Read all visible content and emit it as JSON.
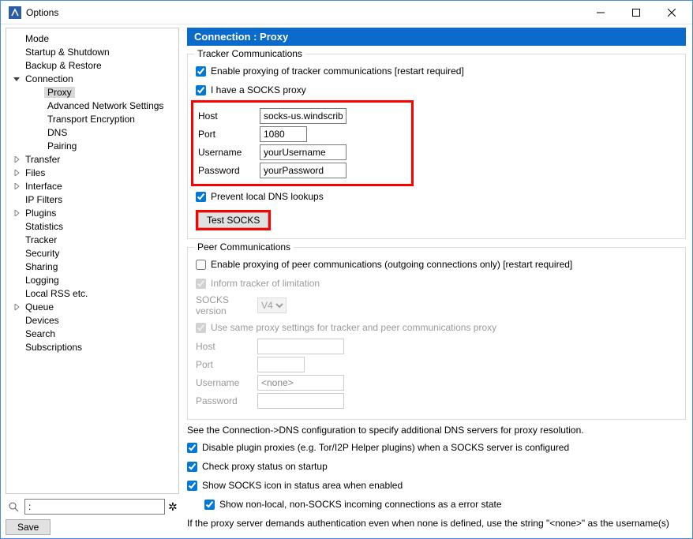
{
  "window": {
    "title": "Options"
  },
  "sidebar": {
    "items": [
      {
        "label": "Mode",
        "level": 1,
        "expand": "none"
      },
      {
        "label": "Startup & Shutdown",
        "level": 1,
        "expand": "none"
      },
      {
        "label": "Backup & Restore",
        "level": 1,
        "expand": "none"
      },
      {
        "label": "Connection",
        "level": 1,
        "expand": "open"
      },
      {
        "label": "Proxy",
        "level": 2,
        "expand": "none",
        "selected": true
      },
      {
        "label": "Advanced Network Settings",
        "level": 2,
        "expand": "none"
      },
      {
        "label": "Transport Encryption",
        "level": 2,
        "expand": "none"
      },
      {
        "label": "DNS",
        "level": 2,
        "expand": "none"
      },
      {
        "label": "Pairing",
        "level": 2,
        "expand": "none"
      },
      {
        "label": "Transfer",
        "level": 1,
        "expand": "closed"
      },
      {
        "label": "Files",
        "level": 1,
        "expand": "closed"
      },
      {
        "label": "Interface",
        "level": 1,
        "expand": "closed"
      },
      {
        "label": "IP Filters",
        "level": 1,
        "expand": "none"
      },
      {
        "label": "Plugins",
        "level": 1,
        "expand": "closed"
      },
      {
        "label": "Statistics",
        "level": 1,
        "expand": "none"
      },
      {
        "label": "Tracker",
        "level": 1,
        "expand": "none"
      },
      {
        "label": "Security",
        "level": 1,
        "expand": "none"
      },
      {
        "label": "Sharing",
        "level": 1,
        "expand": "none"
      },
      {
        "label": "Logging",
        "level": 1,
        "expand": "none"
      },
      {
        "label": "Local RSS etc.",
        "level": 1,
        "expand": "none"
      },
      {
        "label": "Queue",
        "level": 1,
        "expand": "closed"
      },
      {
        "label": "Devices",
        "level": 1,
        "expand": "none"
      },
      {
        "label": "Search",
        "level": 1,
        "expand": "none"
      },
      {
        "label": "Subscriptions",
        "level": 1,
        "expand": "none"
      }
    ],
    "search_value": ":",
    "save_label": "Save"
  },
  "page": {
    "header": "Connection : Proxy",
    "tracker": {
      "legend": "Tracker Communications",
      "enable_proxy": {
        "label": "Enable proxying of tracker communications [restart required]",
        "checked": true
      },
      "have_socks": {
        "label": "I have a SOCKS proxy",
        "checked": true
      },
      "host_label": "Host",
      "host_value": "socks-us.windscribe.",
      "port_label": "Port",
      "port_value": "1080",
      "user_label": "Username",
      "user_value": "yourUsername",
      "pass_label": "Password",
      "pass_value": "yourPassword",
      "prevent_dns": {
        "label": "Prevent local DNS lookups",
        "checked": true
      },
      "test_label": "Test SOCKS"
    },
    "peer": {
      "legend": "Peer Communications",
      "enable_proxy": {
        "label": "Enable proxying of peer communications (outgoing connections only) [restart required]",
        "checked": false
      },
      "inform": {
        "label": "Inform tracker of limitation",
        "checked": true
      },
      "version_label": "SOCKS version",
      "version_value": "V4",
      "same": {
        "label": "Use same proxy settings for tracker and peer communications proxy",
        "checked": true
      },
      "host_label": "Host",
      "host_value": "",
      "port_label": "Port",
      "port_value": "",
      "user_label": "Username",
      "user_value": "<none>",
      "pass_label": "Password",
      "pass_value": ""
    },
    "footer": {
      "dns_note": "See the Connection->DNS configuration to specify additional DNS servers for proxy resolution.",
      "disable_plugin": {
        "label": "Disable plugin proxies (e.g. Tor/I2P Helper plugins) when a SOCKS server is configured",
        "checked": true
      },
      "check_startup": {
        "label": "Check proxy status on startup",
        "checked": true
      },
      "show_icon": {
        "label": "Show SOCKS icon in status area when enabled",
        "checked": true
      },
      "show_nonlocal": {
        "label": "Show non-local, non-SOCKS incoming connections as a error state",
        "checked": true
      },
      "auth_note": "If the proxy server demands authentication even when none is defined, use the string \"<none>\" as the username(s)"
    }
  }
}
